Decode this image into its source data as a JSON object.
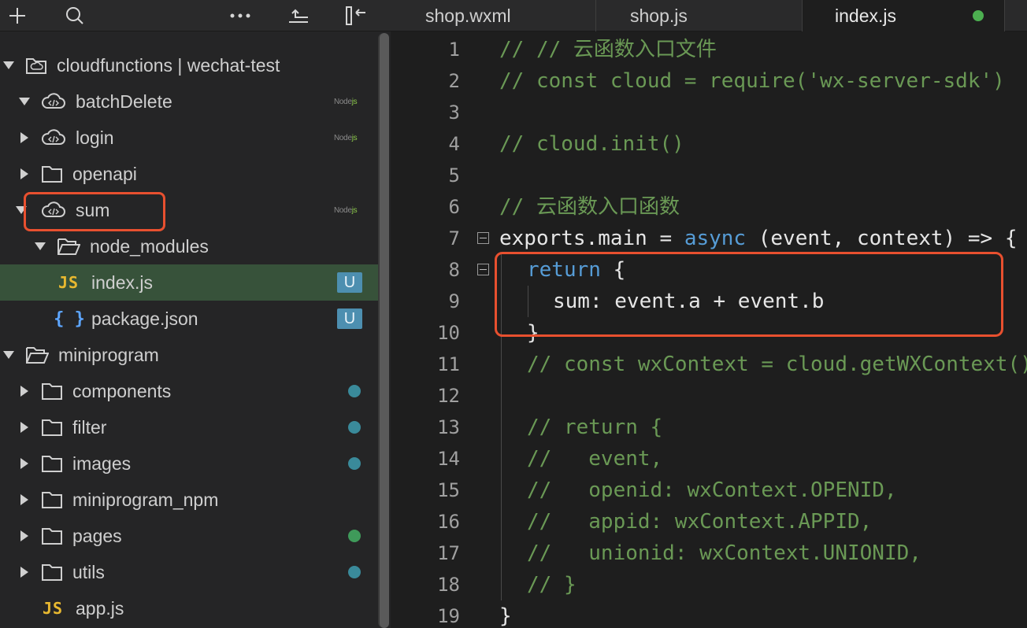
{
  "sidebar": {
    "toolbar": {
      "add_icon": "plus-icon",
      "search_icon": "search-icon",
      "more_icon": "more-dots-icon",
      "collapse_icon": "collapse-all-icon",
      "split_icon": "split-pane-icon"
    },
    "tree": [
      {
        "label": "cloudfunctions | wechat-test",
        "icon": "cloud-folder-icon",
        "expanded": true
      },
      {
        "label": "batchDelete",
        "icon": "cloud-function-icon",
        "expanded": true,
        "runtime": "Node",
        "runtime_suffix": "js"
      },
      {
        "label": "login",
        "icon": "cloud-function-icon",
        "expanded": false,
        "runtime": "Node",
        "runtime_suffix": "js"
      },
      {
        "label": "openapi",
        "icon": "folder-icon",
        "expanded": false
      },
      {
        "label": "sum",
        "icon": "cloud-function-icon",
        "expanded": true,
        "runtime": "Node",
        "runtime_suffix": "js"
      },
      {
        "label": "node_modules",
        "icon": "folder-open-icon",
        "expanded": true
      },
      {
        "label": "index.js",
        "icon_text": "JS",
        "badge": "U",
        "selected": true
      },
      {
        "label": "package.json",
        "icon_text": "{ }",
        "badge": "U"
      },
      {
        "label": "miniprogram",
        "icon": "folder-open-icon",
        "expanded": true
      },
      {
        "label": "components",
        "icon": "folder-icon",
        "status_color": "#3a8a9a"
      },
      {
        "label": "filter",
        "icon": "folder-icon",
        "status_color": "#3a8a9a"
      },
      {
        "label": "images",
        "icon": "folder-icon",
        "status_color": "#3a8a9a"
      },
      {
        "label": "miniprogram_npm",
        "icon": "folder-icon"
      },
      {
        "label": "pages",
        "icon": "folder-icon",
        "status_color": "#3f9a5a"
      },
      {
        "label": "utils",
        "icon": "folder-icon",
        "status_color": "#3a8a9a"
      },
      {
        "label": "app.js",
        "icon_text": "JS"
      }
    ]
  },
  "tabs": [
    {
      "label": "shop.wxml"
    },
    {
      "label": "shop.js"
    },
    {
      "label": "index.js",
      "active": true,
      "status_color": "#4caf50"
    }
  ],
  "editor": {
    "lines": [
      {
        "n": "1",
        "text": "// // 云函数入口文件"
      },
      {
        "n": "2",
        "text": "// const cloud = require('wx-server-sdk')"
      },
      {
        "n": "3",
        "text": ""
      },
      {
        "n": "4",
        "text": "// cloud.init()"
      },
      {
        "n": "5",
        "text": ""
      },
      {
        "n": "6",
        "text": "// 云函数入口函数"
      },
      {
        "n": "7",
        "t1": "exports.main = ",
        "kw": "async",
        "t2": " (event, context) => {"
      },
      {
        "n": "8",
        "kw": "return",
        "t2": " {"
      },
      {
        "n": "9",
        "text": "sum: event.a + event.b"
      },
      {
        "n": "10",
        "text": "}"
      },
      {
        "n": "11",
        "text": "// const wxContext = cloud.getWXContext()"
      },
      {
        "n": "12",
        "text": ""
      },
      {
        "n": "13",
        "text": "// return {"
      },
      {
        "n": "14",
        "text": "//   event,"
      },
      {
        "n": "15",
        "text": "//   openid: wxContext.OPENID,"
      },
      {
        "n": "16",
        "text": "//   appid: wxContext.APPID,"
      },
      {
        "n": "17",
        "text": "//   unionid: wxContext.UNIONID,"
      },
      {
        "n": "18",
        "text": "// }"
      },
      {
        "n": "19",
        "text": "}"
      }
    ]
  }
}
